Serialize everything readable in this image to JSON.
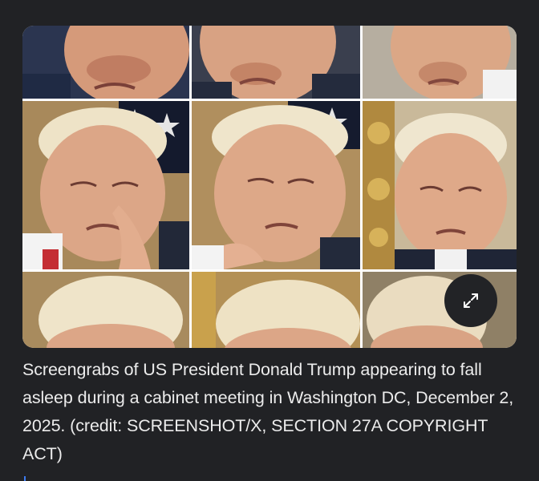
{
  "image": {
    "alt": "Grid of nine screengrabs",
    "expand_icon": "expand-arrows-icon",
    "tile_count": 9
  },
  "caption": {
    "text": "Screengrabs of US President Donald Trump appearing to fall asleep during a cabinet meeting in Washington DC, December 2, 2025. (credit: SCREENSHOT/X, SECTION 27A COPYRIGHT ACT)"
  },
  "colors": {
    "background": "#212225",
    "caption_text": "#ececec",
    "button_bg": "#222326",
    "accent": "#3d7bf0"
  }
}
